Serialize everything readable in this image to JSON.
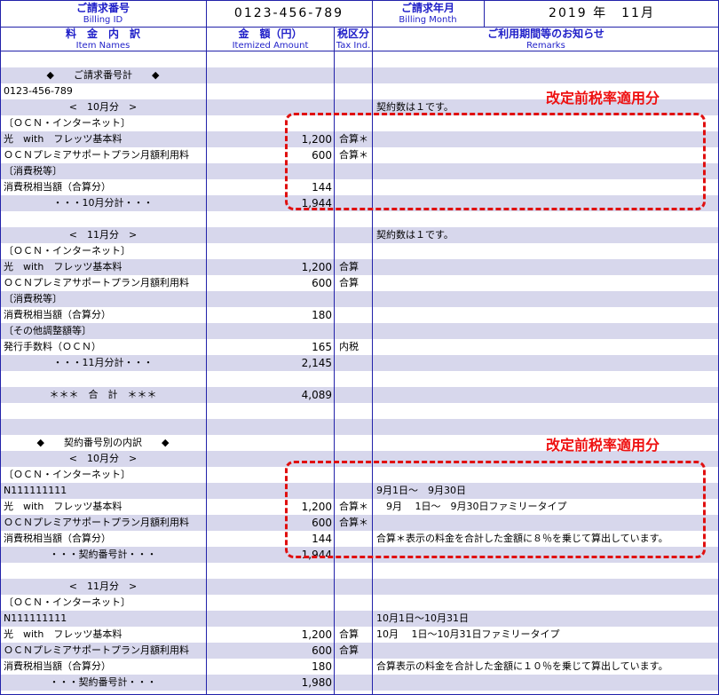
{
  "header": {
    "billing_id_label_jp": "ご請求番号",
    "billing_id_label_en": "Billing ID",
    "billing_id_value": "0123-456-789",
    "billing_month_label_jp": "ご請求年月",
    "billing_month_label_en": "Billing Month",
    "billing_month_value": "2019 年　11月"
  },
  "columns": [
    {
      "jp": "料　金　内　訳",
      "en": "Item Names"
    },
    {
      "jp": "金　額（円）",
      "en": "Itemized Amount"
    },
    {
      "jp": "税区分",
      "en": "Tax Ind."
    },
    {
      "jp": "ご利用期間等のお知らせ",
      "en": "Remarks"
    }
  ],
  "rows": [
    {
      "name": "",
      "amount": "",
      "tax": "",
      "remarks": ""
    },
    {
      "name": "◆　　ご請求番号計　　◆",
      "amount": "",
      "tax": "",
      "remarks": "",
      "center": true
    },
    {
      "name": "0123-456-789",
      "amount": "",
      "tax": "",
      "remarks": ""
    },
    {
      "name": "<　10月分　>",
      "amount": "",
      "tax": "",
      "remarks": "契約数は１です。",
      "center": true
    },
    {
      "name": "〔ＯＣＮ・インターネット〕",
      "amount": "",
      "tax": "",
      "remarks": ""
    },
    {
      "name": "光　with　フレッツ基本料",
      "amount": "1,200",
      "tax": "合算＊",
      "remarks": ""
    },
    {
      "name": "ＯＣＮプレミアサポートプラン月額利用料",
      "amount": "600",
      "tax": "合算＊",
      "remarks": ""
    },
    {
      "name": "〔消費税等〕",
      "amount": "",
      "tax": "",
      "remarks": ""
    },
    {
      "name": "消費税相当額（合算分）",
      "amount": "144",
      "tax": "",
      "remarks": ""
    },
    {
      "name": "・・・10月分計・・・",
      "amount": "1,944",
      "tax": "",
      "remarks": "",
      "center": true
    },
    {
      "name": "",
      "amount": "",
      "tax": "",
      "remarks": ""
    },
    {
      "name": "<　11月分　>",
      "amount": "",
      "tax": "",
      "remarks": "契約数は１です。",
      "center": true
    },
    {
      "name": "〔ＯＣＮ・インターネット〕",
      "amount": "",
      "tax": "",
      "remarks": ""
    },
    {
      "name": "光　with　フレッツ基本料",
      "amount": "1,200",
      "tax": "合算",
      "remarks": ""
    },
    {
      "name": "ＯＣＮプレミアサポートプラン月額利用料",
      "amount": "600",
      "tax": "合算",
      "remarks": ""
    },
    {
      "name": "〔消費税等〕",
      "amount": "",
      "tax": "",
      "remarks": ""
    },
    {
      "name": "消費税相当額（合算分）",
      "amount": "180",
      "tax": "",
      "remarks": ""
    },
    {
      "name": "〔その他調整額等〕",
      "amount": "",
      "tax": "",
      "remarks": ""
    },
    {
      "name": "発行手数料（ＯＣＮ）",
      "amount": "165",
      "tax": "内税",
      "remarks": ""
    },
    {
      "name": "・・・11月分計・・・",
      "amount": "2,145",
      "tax": "",
      "remarks": "",
      "center": true
    },
    {
      "name": "",
      "amount": "",
      "tax": "",
      "remarks": ""
    },
    {
      "name": "＊＊＊　合　計　＊＊＊",
      "amount": "4,089",
      "tax": "",
      "remarks": "",
      "center": true
    },
    {
      "name": "",
      "amount": "",
      "tax": "",
      "remarks": ""
    },
    {
      "name": "",
      "amount": "",
      "tax": "",
      "remarks": ""
    },
    {
      "name": "◆　　契約番号別の内訳　　◆",
      "amount": "",
      "tax": "",
      "remarks": "",
      "center": true
    },
    {
      "name": "<　10月分　>",
      "amount": "",
      "tax": "",
      "remarks": "",
      "center": true
    },
    {
      "name": "〔ＯＣＮ・インターネット〕",
      "amount": "",
      "tax": "",
      "remarks": ""
    },
    {
      "name": "N111111111",
      "amount": "",
      "tax": "",
      "remarks": "9月1日～　9月30日"
    },
    {
      "name": "光　with　フレッツ基本料",
      "amount": "1,200",
      "tax": "合算＊",
      "remarks": "　9月　 1日～　9月30日ファミリータイプ"
    },
    {
      "name": "ＯＣＮプレミアサポートプラン月額利用料",
      "amount": "600",
      "tax": "合算＊",
      "remarks": ""
    },
    {
      "name": "消費税相当額（合算分）",
      "amount": "144",
      "tax": "",
      "remarks": "合算＊表示の料金を合計した金額に８％を乗じて算出しています。"
    },
    {
      "name": "・・・契約番号計・・・",
      "amount": "1,944",
      "tax": "",
      "remarks": "",
      "center": true
    },
    {
      "name": "",
      "amount": "",
      "tax": "",
      "remarks": ""
    },
    {
      "name": "<　11月分　>",
      "amount": "",
      "tax": "",
      "remarks": "",
      "center": true
    },
    {
      "name": "〔ＯＣＮ・インターネット〕",
      "amount": "",
      "tax": "",
      "remarks": ""
    },
    {
      "name": "N111111111",
      "amount": "",
      "tax": "",
      "remarks": "10月1日～10月31日"
    },
    {
      "name": "光　with　フレッツ基本料",
      "amount": "1,200",
      "tax": "合算",
      "remarks": "10月　 1日～10月31日ファミリータイプ"
    },
    {
      "name": "ＯＣＮプレミアサポートプラン月額利用料",
      "amount": "600",
      "tax": "合算",
      "remarks": ""
    },
    {
      "name": "消費税相当額（合算分）",
      "amount": "180",
      "tax": "",
      "remarks": "合算表示の料金を合計した金額に１０％を乗じて算出しています。"
    },
    {
      "name": "・・・契約番号計・・・",
      "amount": "1,980",
      "tax": "",
      "remarks": "",
      "center": true
    }
  ],
  "annotations": {
    "label_1": "改定前税率適用分",
    "label_2": "改定前税率適用分",
    "accent_color": "#ee1111"
  }
}
